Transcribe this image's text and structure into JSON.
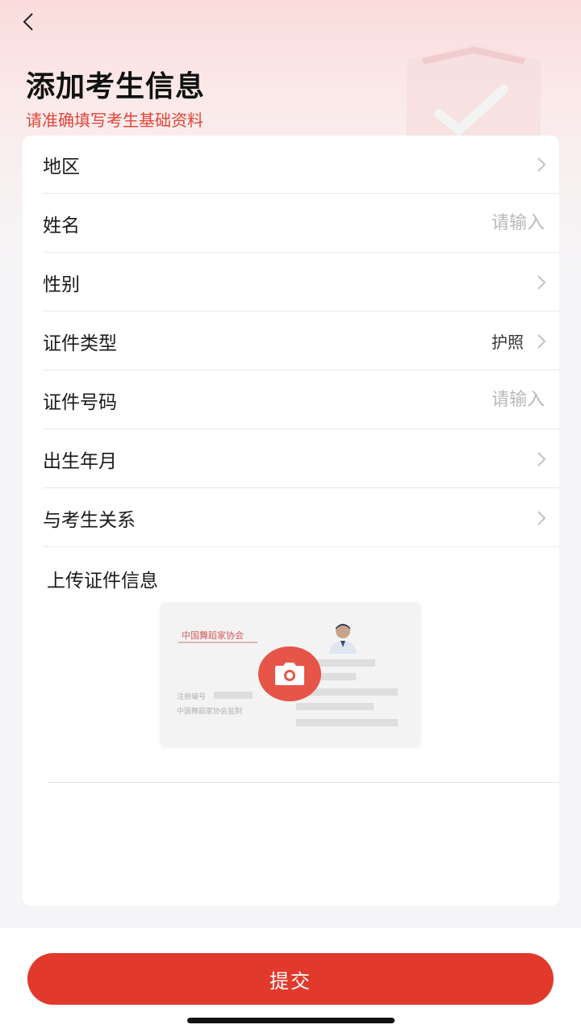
{
  "header": {
    "title": "添加考生信息",
    "subtitle": "请准确填写考生基础资料"
  },
  "form": {
    "rows": [
      {
        "label": "地区",
        "type": "select",
        "value": ""
      },
      {
        "label": "姓名",
        "type": "input",
        "placeholder": "请输入"
      },
      {
        "label": "性别",
        "type": "select",
        "value": ""
      },
      {
        "label": "证件类型",
        "type": "select",
        "value": "护照"
      },
      {
        "label": "证件号码",
        "type": "input",
        "placeholder": "请输入"
      },
      {
        "label": "出生年月",
        "type": "select",
        "value": ""
      },
      {
        "label": "与考生关系",
        "type": "select",
        "value": ""
      }
    ]
  },
  "upload": {
    "title": "上传证件信息",
    "card_org": "中国舞蹈家协会",
    "card_reg_label": "注册编号",
    "card_supervise": "中国舞蹈家协会监制"
  },
  "footer": {
    "submit_label": "提交"
  },
  "colors": {
    "accent": "#e1392c",
    "subtitle": "#e0453a",
    "camera": "#e65548"
  }
}
